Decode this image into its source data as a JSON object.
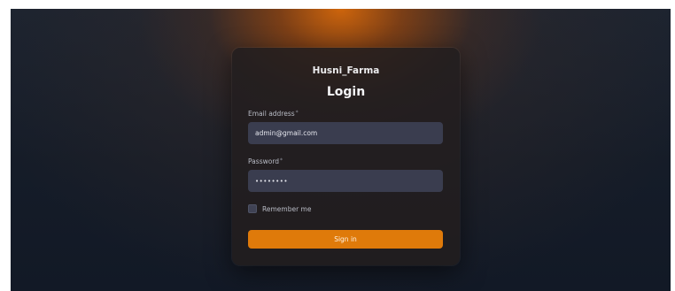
{
  "app": {
    "brand": "Husni_Farma"
  },
  "login": {
    "title": "Login",
    "email": {
      "label": "Email address",
      "required_mark": "*",
      "value": "admin@gmail.com"
    },
    "password": {
      "label": "Password",
      "required_mark": "*",
      "masked_value": "••••••••"
    },
    "remember_me": {
      "label": "Remember me",
      "checked": false
    },
    "submit_label": "Sign in"
  },
  "colors": {
    "accent": "#df7a0a",
    "card": "#221e1f",
    "input": "#3a3d4f",
    "background": "#151c28"
  }
}
